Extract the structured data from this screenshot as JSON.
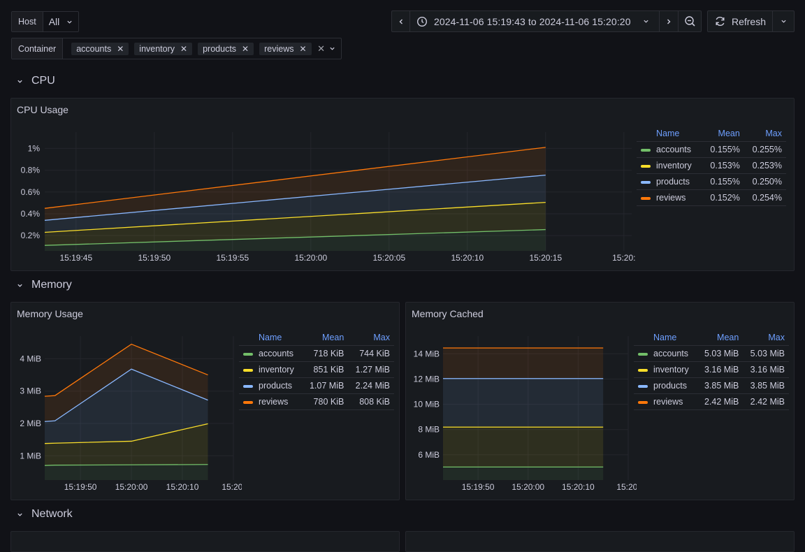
{
  "variables": {
    "host": {
      "label": "Host",
      "value": "All"
    },
    "container": {
      "label": "Container",
      "selected": [
        "accounts",
        "inventory",
        "products",
        "reviews"
      ]
    }
  },
  "time_picker": {
    "range": "2024-11-06 15:19:43 to 2024-11-06 15:20:20",
    "refresh_label": "Refresh"
  },
  "rows": {
    "cpu": "CPU",
    "memory": "Memory",
    "network": "Network"
  },
  "colors": {
    "accounts": "#73bf69",
    "inventory": "#fade2a",
    "products": "#8ab8ff",
    "reviews": "#ff780a",
    "legend_header": "#6e9fff"
  },
  "legend_headers": {
    "name": "Name",
    "mean": "Mean",
    "max": "Max"
  },
  "panels": {
    "cpu_usage": {
      "title": "CPU Usage",
      "legend": [
        {
          "name": "accounts",
          "mean": "0.155%",
          "max": "0.255%"
        },
        {
          "name": "inventory",
          "mean": "0.153%",
          "max": "0.253%"
        },
        {
          "name": "products",
          "mean": "0.155%",
          "max": "0.250%"
        },
        {
          "name": "reviews",
          "mean": "0.152%",
          "max": "0.254%"
        }
      ]
    },
    "memory_usage": {
      "title": "Memory Usage",
      "legend": [
        {
          "name": "accounts",
          "mean": "718 KiB",
          "max": "744 KiB"
        },
        {
          "name": "inventory",
          "mean": "851 KiB",
          "max": "1.27 MiB"
        },
        {
          "name": "products",
          "mean": "1.07 MiB",
          "max": "2.24 MiB"
        },
        {
          "name": "reviews",
          "mean": "780 KiB",
          "max": "808 KiB"
        }
      ]
    },
    "memory_cached": {
      "title": "Memory Cached",
      "legend": [
        {
          "name": "accounts",
          "mean": "5.03 MiB",
          "max": "5.03 MiB"
        },
        {
          "name": "inventory",
          "mean": "3.16 MiB",
          "max": "3.16 MiB"
        },
        {
          "name": "products",
          "mean": "3.85 MiB",
          "max": "3.85 MiB"
        },
        {
          "name": "reviews",
          "mean": "2.42 MiB",
          "max": "2.42 MiB"
        }
      ]
    }
  },
  "chart_data": [
    {
      "id": "cpu",
      "type": "area",
      "stacked": true,
      "title": "CPU Usage",
      "x_ticks": [
        "15:19:45",
        "15:19:50",
        "15:19:55",
        "15:20:00",
        "15:20:05",
        "15:20:10",
        "15:20:15",
        "15:20:"
      ],
      "x_tick_seconds": [
        45,
        50,
        55,
        60,
        65,
        70,
        75,
        80
      ],
      "xlim_seconds": [
        43,
        80.5
      ],
      "y_ticks": [
        "0.2%",
        "0.4%",
        "0.6%",
        "0.8%",
        "1%"
      ],
      "y_tick_values": [
        0.2,
        0.4,
        0.6,
        0.8,
        1.0
      ],
      "ylim": [
        0.06,
        1.15
      ],
      "x": [
        43,
        75
      ],
      "series_stacked_tops": [
        {
          "name": "accounts",
          "values": [
            0.11,
            0.255
          ]
        },
        {
          "name": "inventory",
          "values": [
            0.23,
            0.505
          ]
        },
        {
          "name": "products",
          "values": [
            0.34,
            0.755
          ]
        },
        {
          "name": "reviews",
          "values": [
            0.45,
            1.01
          ]
        }
      ]
    },
    {
      "id": "memory_usage",
      "type": "area",
      "stacked": true,
      "title": "Memory Usage",
      "x_ticks": [
        "15:19:50",
        "15:20:00",
        "15:20:10",
        "15:20:"
      ],
      "x_tick_seconds": [
        50,
        60,
        70,
        80
      ],
      "xlim_seconds": [
        43,
        80
      ],
      "y_ticks": [
        "1 MiB",
        "2 MiB",
        "3 MiB",
        "4 MiB"
      ],
      "y_tick_values": [
        1,
        2,
        3,
        4
      ],
      "ylim": [
        0.25,
        4.7
      ],
      "x": [
        43,
        45,
        60,
        75
      ],
      "series_stacked_tops": [
        {
          "name": "accounts",
          "values": [
            0.7,
            0.71,
            0.72,
            0.73
          ]
        },
        {
          "name": "inventory",
          "values": [
            1.38,
            1.39,
            1.45,
            1.99
          ]
        },
        {
          "name": "products",
          "values": [
            2.06,
            2.08,
            3.68,
            2.72
          ]
        },
        {
          "name": "reviews",
          "values": [
            2.84,
            2.86,
            4.45,
            3.5
          ]
        }
      ]
    },
    {
      "id": "memory_cached",
      "type": "area",
      "stacked": true,
      "title": "Memory Cached",
      "x_ticks": [
        "15:19:50",
        "15:20:00",
        "15:20:10",
        "15:20:"
      ],
      "x_tick_seconds": [
        50,
        60,
        70,
        80
      ],
      "xlim_seconds": [
        43,
        80
      ],
      "y_ticks": [
        "6 MiB",
        "8 MiB",
        "10 MiB",
        "12 MiB",
        "14 MiB"
      ],
      "y_tick_values": [
        6,
        8,
        10,
        12,
        14
      ],
      "ylim": [
        4.0,
        15.4
      ],
      "x": [
        43,
        75
      ],
      "series_stacked_tops": [
        {
          "name": "accounts",
          "values": [
            5.03,
            5.03
          ]
        },
        {
          "name": "inventory",
          "values": [
            8.19,
            8.19
          ]
        },
        {
          "name": "products",
          "values": [
            12.04,
            12.04
          ]
        },
        {
          "name": "reviews",
          "values": [
            14.46,
            14.46
          ]
        }
      ]
    }
  ]
}
